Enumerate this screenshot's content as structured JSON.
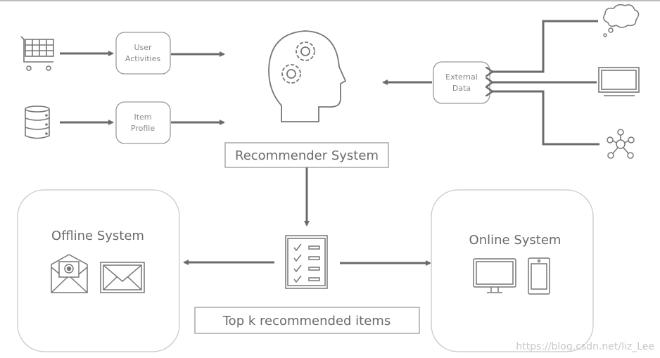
{
  "inputs": {
    "user_activities": [
      "User",
      "Activities"
    ],
    "item_profile": [
      "Item",
      "Profile"
    ],
    "external_data": [
      "External",
      "Data"
    ]
  },
  "recommender_label": "Recommender System",
  "output_label": "Top k recommended items",
  "offline_label": "Offline System",
  "online_label": "Online System",
  "watermark": "https://blog.csdn.net/liz_Lee",
  "colors": {
    "line": "#6b6b6b",
    "icon": "#777777",
    "box_border": "#9a9a9a"
  },
  "icons": [
    "shopping-cart-icon",
    "database-icon",
    "head-gears-icon",
    "cloud-thought-icon",
    "monitor-icon",
    "network-icon",
    "checklist-icon",
    "open-envelope-icon",
    "envelope-icon",
    "desktop-icon",
    "smartphone-icon"
  ]
}
